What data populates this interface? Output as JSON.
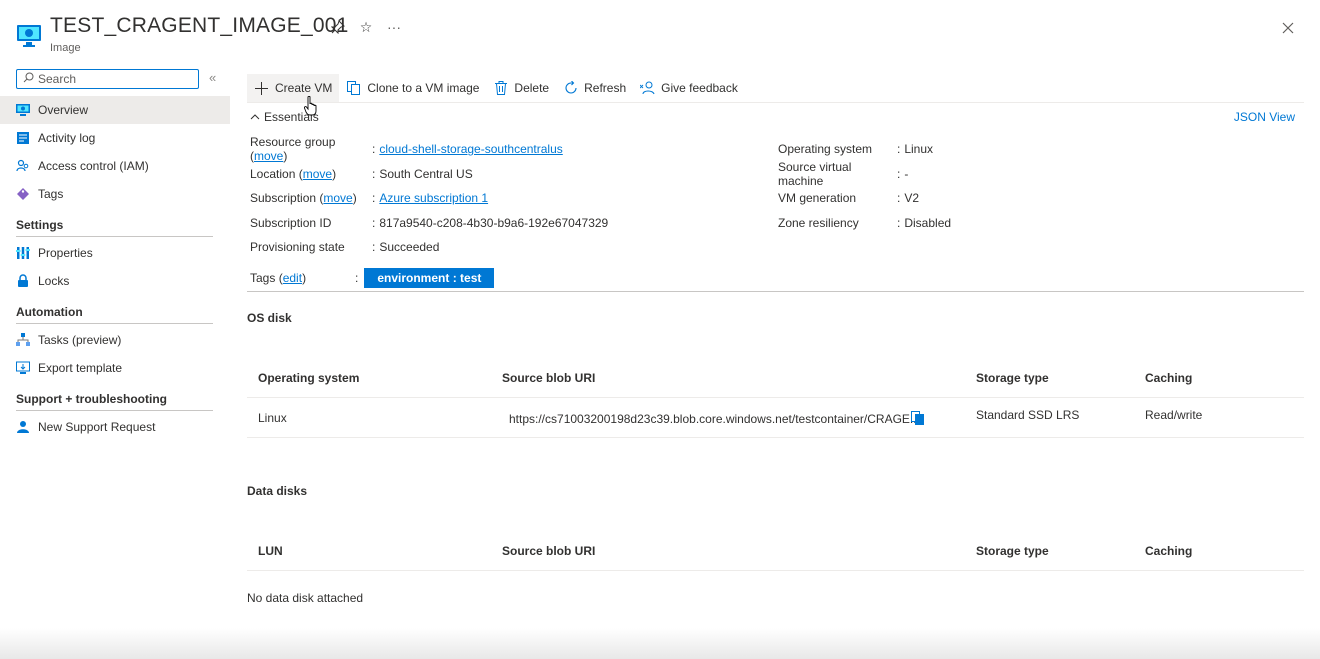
{
  "header": {
    "title": "TEST_CRAGENT_IMAGE_001",
    "subtitle": "Image",
    "icons": [
      "pin-icon",
      "star-icon",
      "more-icon",
      "close-icon"
    ]
  },
  "sidebar": {
    "search_placeholder": "Search",
    "items": [
      {
        "label": "Overview",
        "icon": "monitor-icon",
        "active": true
      },
      {
        "label": "Activity log",
        "icon": "log-icon"
      },
      {
        "label": "Access control (IAM)",
        "icon": "people-icon"
      },
      {
        "label": "Tags",
        "icon": "tag-icon"
      }
    ],
    "sections": [
      {
        "title": "Settings",
        "items": [
          {
            "label": "Properties",
            "icon": "properties-icon"
          },
          {
            "label": "Locks",
            "icon": "lock-icon"
          }
        ]
      },
      {
        "title": "Automation",
        "items": [
          {
            "label": "Tasks (preview)",
            "icon": "tasks-icon"
          },
          {
            "label": "Export template",
            "icon": "export-icon"
          }
        ]
      },
      {
        "title": "Support + troubleshooting",
        "items": [
          {
            "label": "New Support Request",
            "icon": "support-icon"
          }
        ]
      }
    ]
  },
  "toolbar": {
    "create_vm": "Create VM",
    "clone": "Clone to a VM image",
    "delete": "Delete",
    "refresh": "Refresh",
    "feedback": "Give feedback"
  },
  "essentials": {
    "toggle_label": "Essentials",
    "json_view": "JSON View",
    "left": {
      "resource_group_label": "Resource group",
      "resource_group_move": "move",
      "resource_group_value": "cloud-shell-storage-southcentralus",
      "location_label": "Location",
      "location_move": "move",
      "location_value": "South Central US",
      "subscription_label": "Subscription",
      "subscription_move": "move",
      "subscription_value": "Azure subscription 1",
      "subscription_id_label": "Subscription ID",
      "subscription_id_value": "817a9540-c208-4b30-b9a6-192e67047329",
      "provisioning_label": "Provisioning state",
      "provisioning_value": "Succeeded"
    },
    "right": {
      "os_label": "Operating system",
      "os_value": "Linux",
      "source_vm_label": "Source virtual machine",
      "source_vm_value": "-",
      "vm_gen_label": "VM generation",
      "vm_gen_value": "V2",
      "zone_label": "Zone resiliency",
      "zone_value": "Disabled"
    },
    "tags_label": "Tags",
    "tags_edit": "edit",
    "tag_value": "environment : test",
    "sep": ":",
    "sep_lead": ": "
  },
  "os_disk": {
    "title": "OS disk",
    "columns": [
      "Operating system",
      "Source blob URI",
      "Storage type",
      "Caching"
    ],
    "row": {
      "os": "Linux",
      "uri": "https://cs71003200198d23c39.blob.core.windows.net/testcontainer/CRAGE...",
      "storage": "Standard SSD LRS",
      "caching": "Read/write"
    }
  },
  "data_disks": {
    "title": "Data disks",
    "columns": [
      "LUN",
      "Source blob URI",
      "Storage type",
      "Caching"
    ],
    "empty": "No data disk attached"
  }
}
